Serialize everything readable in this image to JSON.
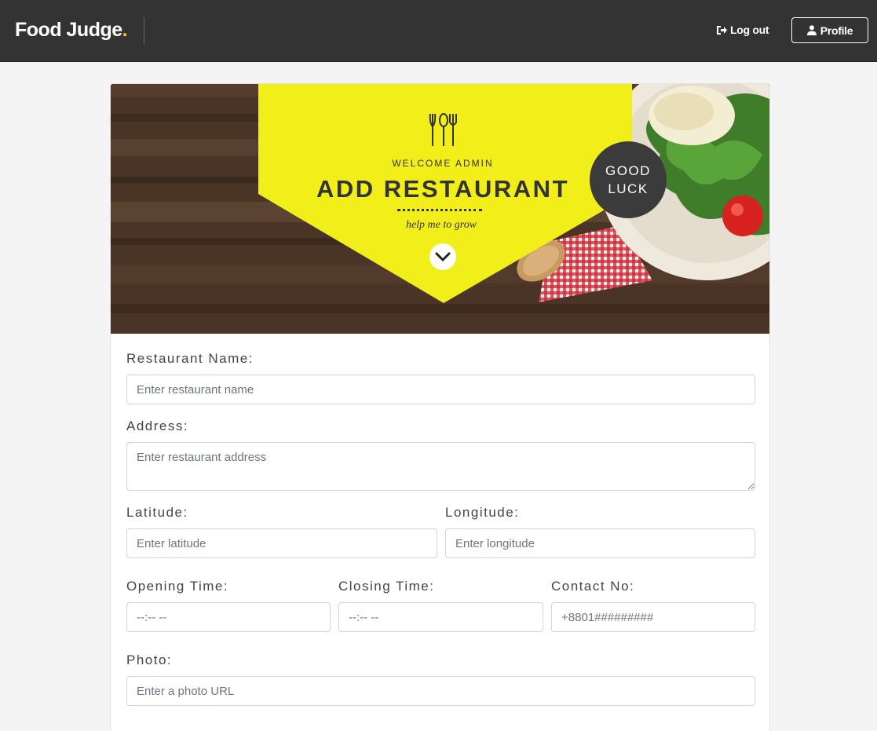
{
  "nav": {
    "brand": "Food Judge",
    "brand_dot": ".",
    "logout_label": "Log out",
    "profile_label": "Profile"
  },
  "banner": {
    "welcome": "WELCOME ADMIN",
    "title": "ADD RESTAURANT",
    "tagline": "help me to grow",
    "badge_line1": "GOOD",
    "badge_line2": "LUCK"
  },
  "form": {
    "restaurant_name": {
      "label": "Restaurant Name:",
      "placeholder": "Enter restaurant name"
    },
    "address": {
      "label": "Address:",
      "placeholder": "Enter restaurant address"
    },
    "latitude": {
      "label": "Latitude:",
      "placeholder": "Enter latitude"
    },
    "longitude": {
      "label": "Longitude:",
      "placeholder": "Enter longitude"
    },
    "opening_time": {
      "label": "Opening Time:",
      "placeholder": "--:-- --"
    },
    "closing_time": {
      "label": "Closing Time:",
      "placeholder": "--:-- --"
    },
    "contact_no": {
      "label": "Contact No:",
      "placeholder": "+8801#########"
    },
    "photo": {
      "label": "Photo:",
      "placeholder": "Enter a photo URL"
    }
  },
  "colors": {
    "navbar": "#333333",
    "accent_yellow": "#f2ee1a",
    "brand_dot": "#f5c518"
  }
}
